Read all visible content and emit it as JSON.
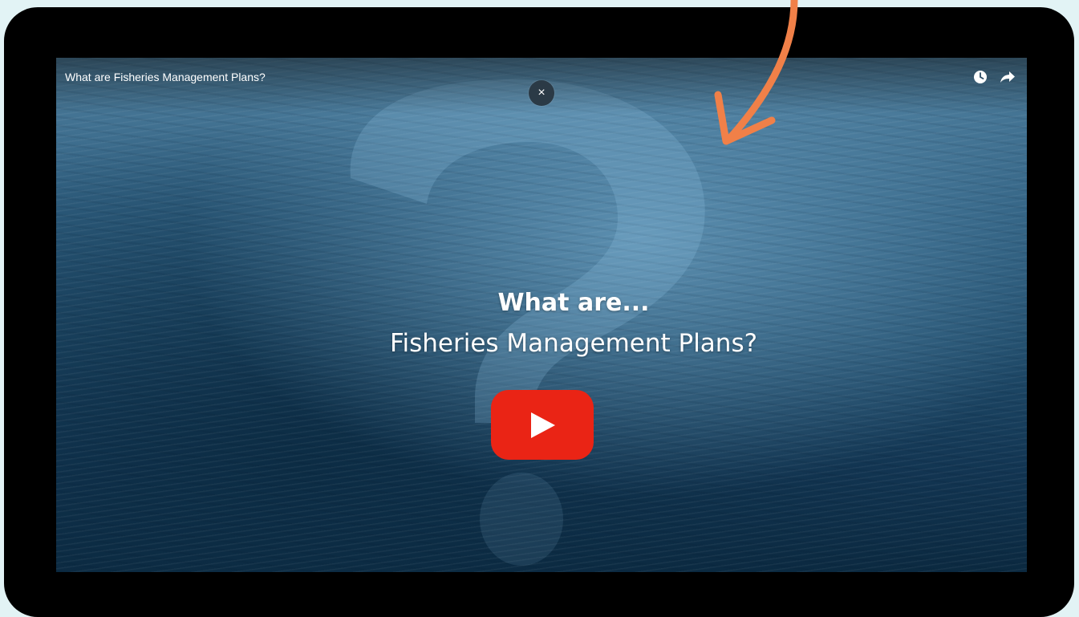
{
  "video": {
    "title": "What are Fisheries Management Plans?",
    "headline_line1": "What are...",
    "headline_line2": "Fisheries Management Plans?",
    "close_label": "×",
    "icons": {
      "watch_later": "clock-icon",
      "share": "share-arrow-icon",
      "play": "youtube-play-icon",
      "close": "close-icon"
    }
  },
  "colors": {
    "page_background": "#e2f3f5",
    "frame": "#000000",
    "play_button": "#ea2415",
    "arrow": "#f08048"
  }
}
